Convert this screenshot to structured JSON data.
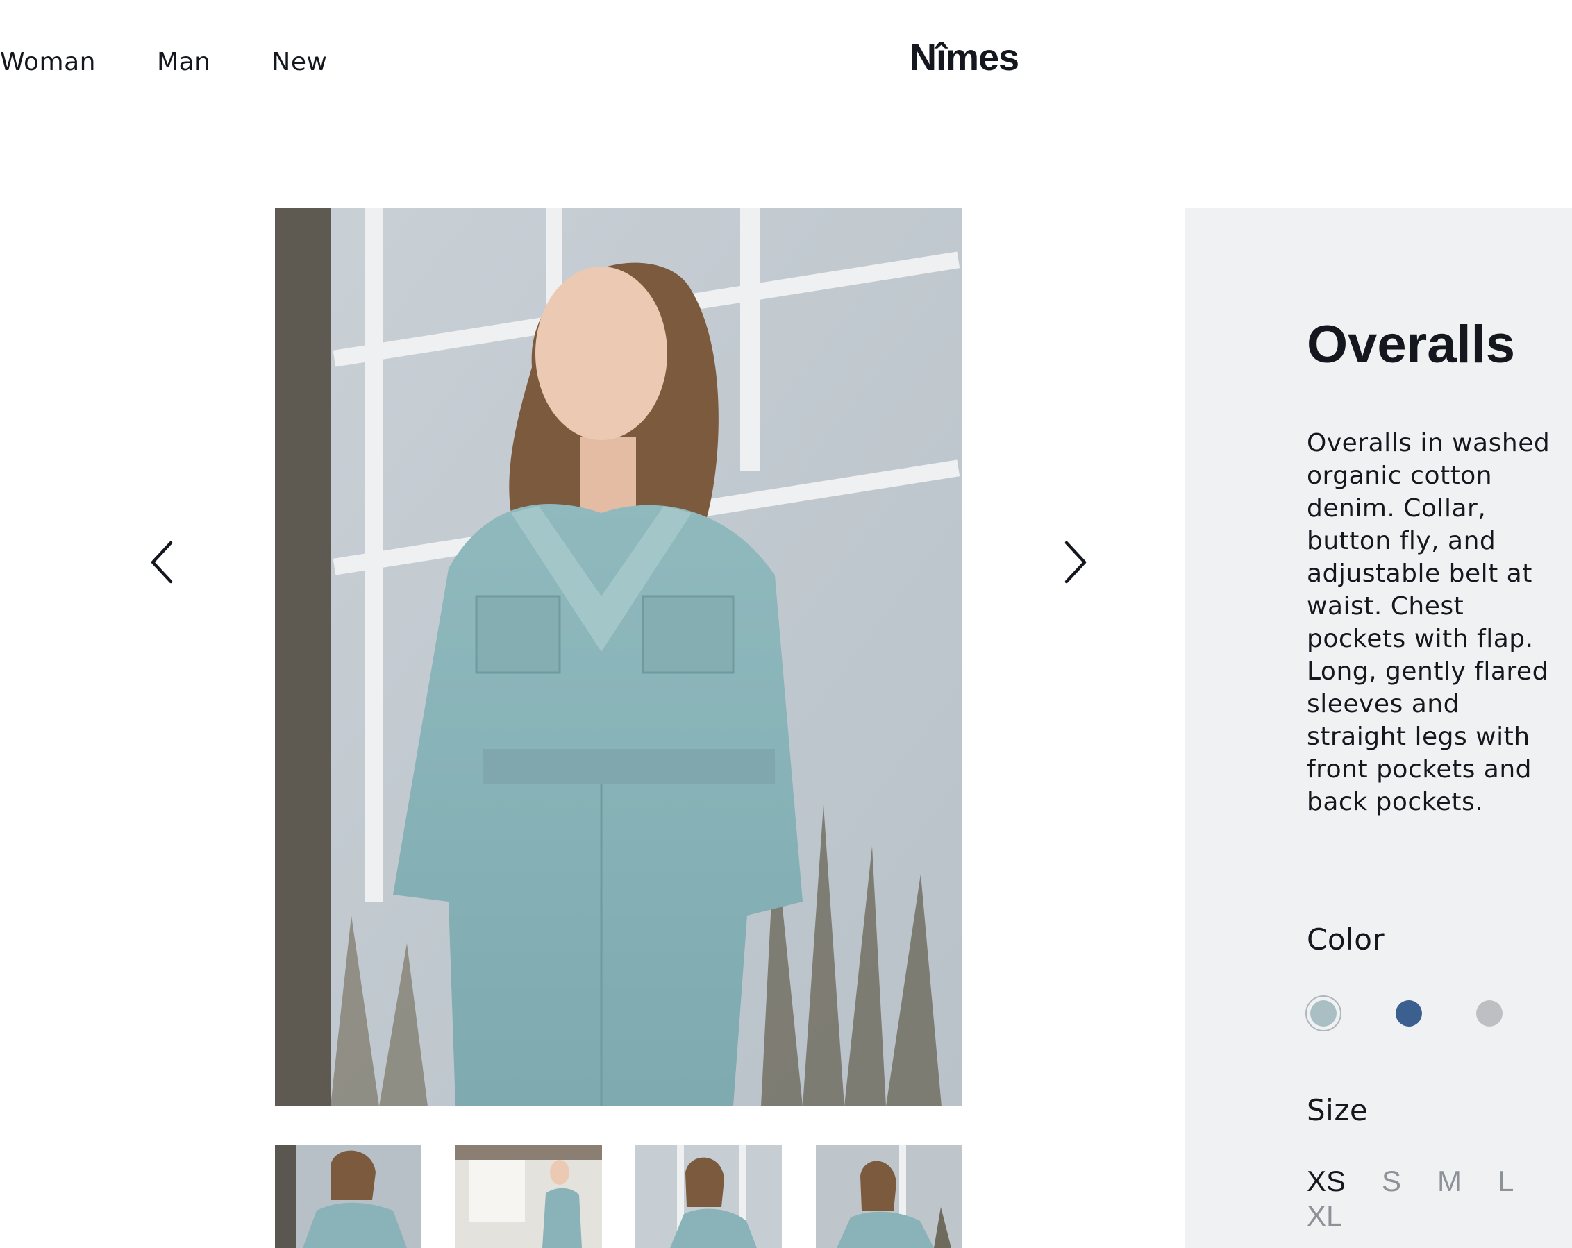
{
  "nav": {
    "items": [
      {
        "label": "Woman"
      },
      {
        "label": "Man"
      },
      {
        "label": "New"
      }
    ]
  },
  "brand": {
    "name": "Nîmes"
  },
  "gallery": {
    "prev_icon": "chevron-left-icon",
    "next_icon": "chevron-right-icon",
    "thumbnails": 4
  },
  "product": {
    "title": "Overalls",
    "description": "Overalls in washed organic cotton denim. Collar, button fly, and adjustable belt at waist. Chest pockets with flap. Long, gently flared sleeves and straight legs with front pockets and back pockets.",
    "color_label": "Color",
    "colors": [
      "#a9bfc4",
      "#3b5f8f",
      "#bdbfc2"
    ],
    "selected_color_index": 0,
    "size_label": "Size",
    "sizes": [
      "XS",
      "S",
      "M",
      "L",
      "XL"
    ],
    "selected_size": "XS"
  },
  "palette": {
    "text": "#14181e",
    "muted": "#8c9298",
    "panel": "#f0f1f2"
  }
}
